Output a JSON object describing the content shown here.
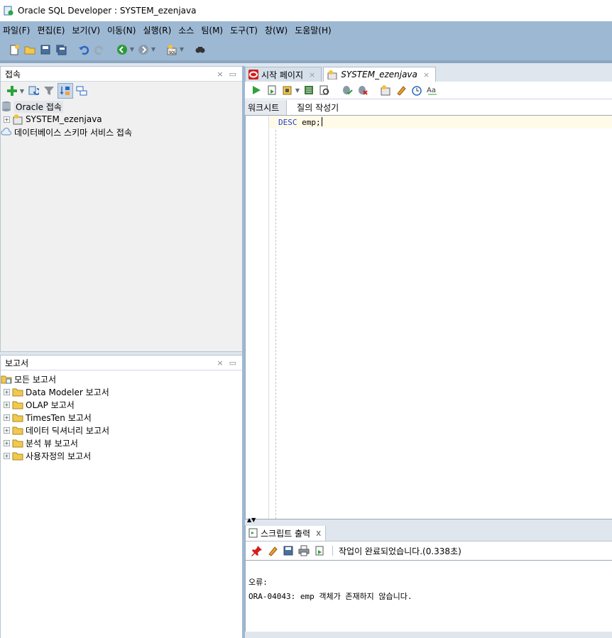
{
  "window": {
    "title": "Oracle SQL Developer : SYSTEM_ezenjava"
  },
  "menu": [
    "파일(F)",
    "편집(E)",
    "보기(V)",
    "이동(N)",
    "실행(R)",
    "소스",
    "팀(M)",
    "도구(T)",
    "창(W)",
    "도움말(H)"
  ],
  "connections_panel": {
    "title": "접속",
    "tree": {
      "root": "Oracle 접속",
      "child": "SYSTEM_ezenjava",
      "cloud": "데이터베이스 스키마 서비스 접속"
    }
  },
  "reports_panel": {
    "title": "보고서",
    "root": "모든 보고서",
    "items": [
      "Data Modeler 보고서",
      "OLAP 보고서",
      "TimesTen 보고서",
      "데이터 딕셔너리 보고서",
      "분석 뷰 보고서",
      "사용자정의 보고서"
    ]
  },
  "editor": {
    "tabs": [
      "시작 페이지",
      "SYSTEM_ezenjava"
    ],
    "subtabs": [
      "워크시트",
      "질의 작성기"
    ],
    "sql_keyword": "DESC",
    "sql_rest": " emp;"
  },
  "script_output": {
    "tab_label": "스크립트 출력",
    "tab_close": "x",
    "status": "작업이 완료되었습니다.(0.338초)",
    "lines": [
      "오류:",
      "ORA-04043: emp 객체가 존재하지 않습니다."
    ]
  },
  "colors": {
    "menubar": "#9db8d2",
    "keyword": "#1f3fd0",
    "current_line": "#fffbe8"
  }
}
